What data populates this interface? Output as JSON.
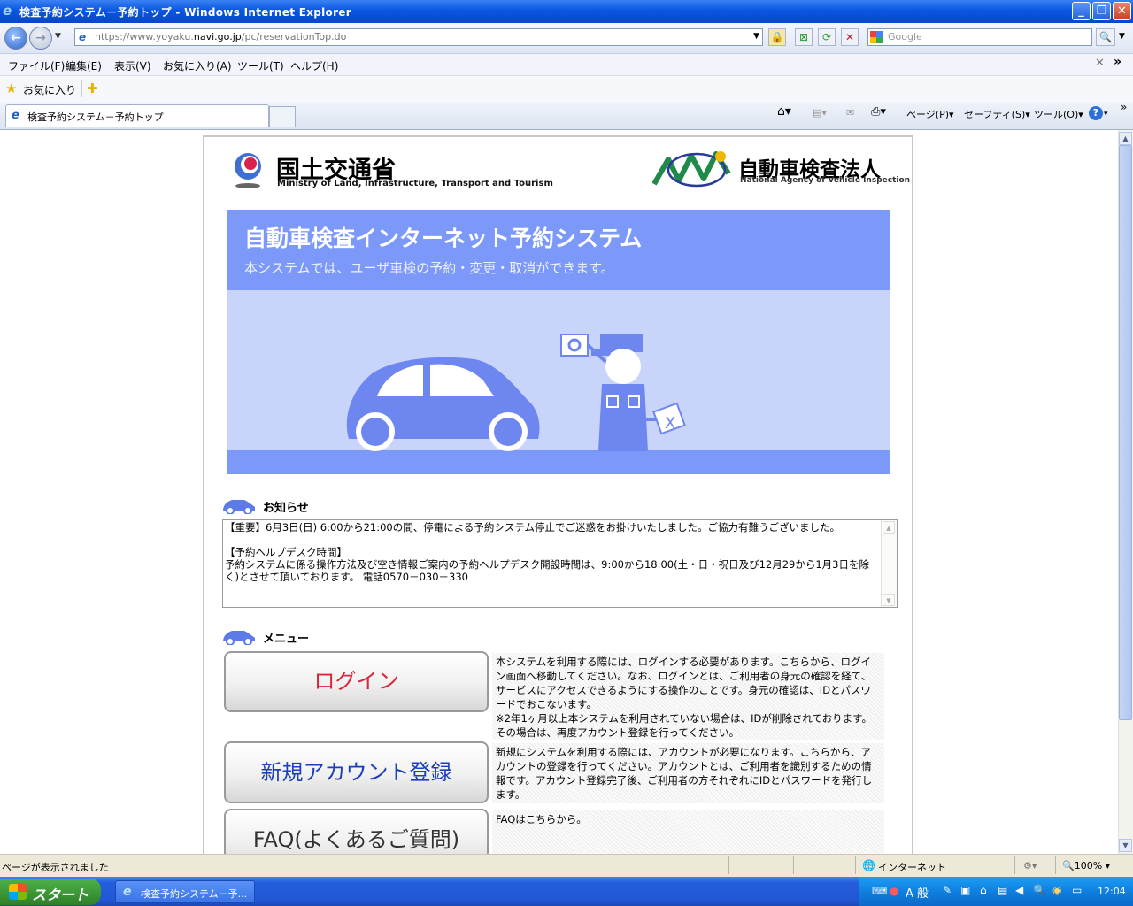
{
  "window": {
    "title": "検査予約システム－予約トップ - Windows Internet Explorer"
  },
  "address": {
    "url_prefix": "https://www.yoyaku.",
    "url_host": "navi.go.jp",
    "url_path": "/pc/reservationTop.do",
    "search_placeholder": "Google"
  },
  "menu": [
    "ファイル(F)",
    "編集(E)",
    "表示(V)",
    "お気に入り(A)",
    "ツール(T)",
    "ヘルプ(H)"
  ],
  "favorites": {
    "label": "お気に入り"
  },
  "tabs": [
    {
      "label": "検査予約システム－予約トップ"
    }
  ],
  "commands": {
    "page": "ページ(P)",
    "safety": "セーフティ(S)",
    "tools": "ツール(O)"
  },
  "page": {
    "logo_left": {
      "title": "国土交通省",
      "subtitle": "Ministry of Land, Infrastructure, Transport and Tourism"
    },
    "logo_right": {
      "title": "自動車検査法人",
      "subtitle": "National Agency of Vehicle Inspection"
    },
    "hero": {
      "title": "自動車検査インターネット予約システム",
      "subtitle": "本システムでは、ユーザ車検の予約・変更・取消ができます。"
    },
    "notice": {
      "heading": "お知らせ",
      "text": "【重要】6月3日(日) 6:00から21:00の間、停電による予約システム停止でご迷惑をお掛けいたしました。ご協力有難うございました。\n\n【予約ヘルプデスク時間】\n予約システムに係る操作方法及び空き情報ご案内の予約ヘルプデスク開設時間は、9:00から18:00(土・日・祝日及び12月29から1月3日を除く)とさせて頂いております。 電話0570－030－330"
    },
    "menu_section": {
      "heading": "メニュー",
      "items": [
        {
          "label": "ログイン",
          "description": "本システムを利用する際には、ログインする必要があります。こちらから、ログイン画面へ移動してください。なお、ログインとは、ご利用者の身元の確認を経て、サービスにアクセスできるようにする操作のことです。身元の確認は、IDとパスワードでおこないます。\n※2年1ヶ月以上本システムを利用されていない場合は、IDが削除されております。その場合は、再度アカウント登録を行ってください。",
          "color": "#d8263b"
        },
        {
          "label": "新規アカウント登録",
          "description": "新規にシステムを利用する際には、アカウントが必要になります。こちらから、アカウントの登録を行ってください。アカウントとは、ご利用者を識別するための情報です。アカウント登録完了後、ご利用者の方それぞれにIDとパスワードを発行します。",
          "color": "#1d3fb8"
        },
        {
          "label": "FAQ(よくあるご質問)",
          "description": "FAQはこちらから。",
          "color": "#333333"
        }
      ]
    }
  },
  "status": {
    "text": "ページが表示されました",
    "zone": "インターネット",
    "zoom": "100%"
  },
  "taskbar": {
    "start": "スタート",
    "task": "検査予約システム－予...",
    "ime": "A 般",
    "clock": "12:04"
  },
  "colors": {
    "hero_blue": "#7c98f8",
    "hero_light": "#c8d4fa",
    "titlebar": "#0a56e0"
  }
}
